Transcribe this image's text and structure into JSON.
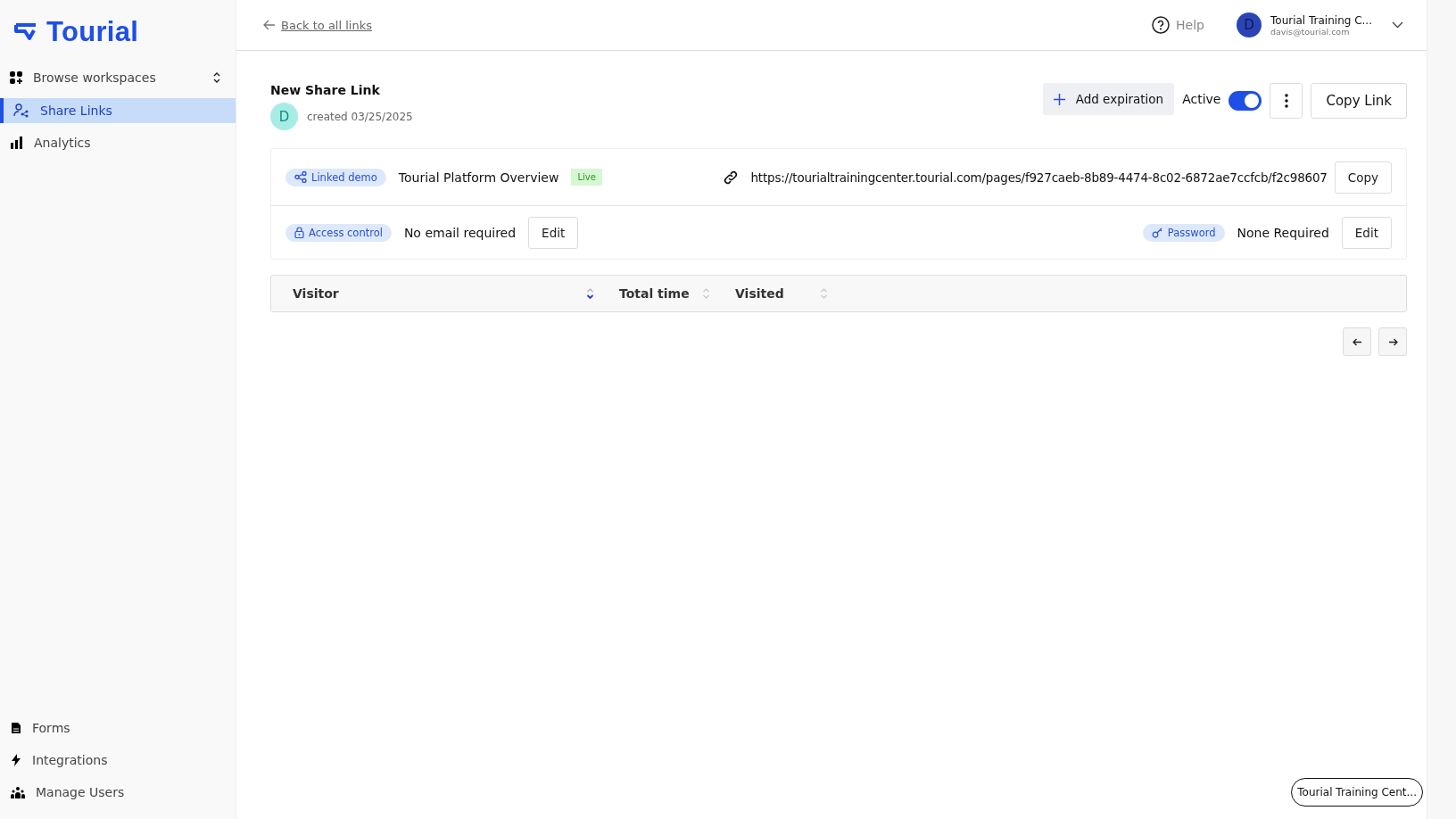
{
  "sidebar": {
    "logo": "Tourial",
    "workspace": "Browse workspaces",
    "items": [
      {
        "label": "Share Links",
        "selected": true
      },
      {
        "label": "Analytics",
        "selected": false
      }
    ],
    "bottom_items": [
      {
        "label": "Forms",
        "selected": false
      },
      {
        "label": "Integrations",
        "selected": false
      },
      {
        "label": "Manage Users",
        "selected": false
      }
    ]
  },
  "header": {
    "back_link": "Back to all links",
    "help": "Help",
    "account": {
      "avatar": "D",
      "name": "Tourial Training C...",
      "email": "davis@tourial.com"
    }
  },
  "link": {
    "title": "New Share Link",
    "avatar": "D",
    "created": "created 03/25/2025",
    "add_expiration": "Add expiration",
    "active": {
      "label": "Active",
      "on": true
    },
    "copy_link": "Copy Link",
    "linked_demo": {
      "tag": "Linked demo",
      "name": "Tourial Platform Overview",
      "status": "Live",
      "url": "https://tourialtrainingcenter.tourial.com/pages/f927caeb-8b89-4474-8c02-6872ae7ccfcb/f2c98607",
      "copy": "Copy"
    },
    "access_control": {
      "tag": "Access control",
      "value": "No email required",
      "edit": "Edit"
    },
    "password": {
      "tag": "Password",
      "value": "None Required",
      "edit": "Edit"
    }
  },
  "table": {
    "columns": [
      {
        "label": "Visitor",
        "sorted": true
      },
      {
        "label": "Total time",
        "sorted": false
      },
      {
        "label": "Visited",
        "sorted": false
      }
    ]
  },
  "workspace_chip": "Tourial Training Cent..."
}
